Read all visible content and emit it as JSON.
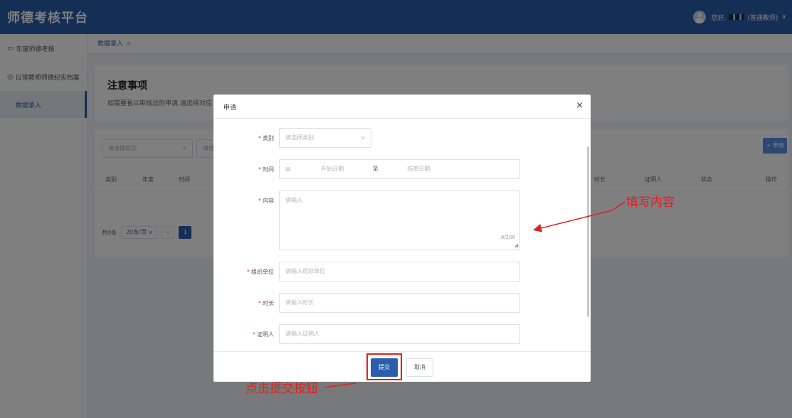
{
  "app": {
    "title": "师德考核平台"
  },
  "user": {
    "greeting": "您好,",
    "role": "(普通教师)",
    "caret": "∨"
  },
  "sidebar": {
    "items": [
      {
        "icon": "monitor-icon",
        "label": "年度师德考核"
      },
      {
        "icon": "circle-icon",
        "label": "日常教师师德纪实档案"
      },
      {
        "label": "数据录入"
      }
    ]
  },
  "tabs": [
    {
      "label": "数据录入",
      "close": "×"
    }
  ],
  "notice": {
    "title": "注意事项",
    "text": "如需要看以审核过的申请,请选择对应"
  },
  "filters": {
    "category_placeholder": "请选择类别",
    "second_placeholder": "请选",
    "apply_button": "+ 申请"
  },
  "table": {
    "headers": [
      "类别",
      "年度",
      "时间",
      "时长",
      "证明人",
      "状态",
      "操作"
    ]
  },
  "pagination": {
    "total": "共0条",
    "page_size": "20条/页",
    "prev": "<",
    "current": "1"
  },
  "modal": {
    "title": "申请",
    "close": "×",
    "fields": {
      "category": {
        "label": "类别",
        "placeholder": "请选择类别"
      },
      "time": {
        "label": "时间",
        "start_placeholder": "开始日期",
        "separator": "至",
        "end_placeholder": "结束日期"
      },
      "content": {
        "label": "内容",
        "placeholder": "请输入",
        "counter": "0/200"
      },
      "org": {
        "label": "组织单位",
        "placeholder": "请输入组织单位"
      },
      "duration": {
        "label": "时长",
        "placeholder": "请输入时长"
      },
      "witness": {
        "label": "证明人",
        "placeholder": "请输入证明人"
      }
    },
    "submit_label": "提交",
    "cancel_label": "取消"
  },
  "annotations": {
    "fill_content": "填写内容",
    "click_submit": "点击提交按钮"
  },
  "colors": {
    "primary": "#2a5dab",
    "annotation": "#e02020",
    "required": "#e53935"
  }
}
